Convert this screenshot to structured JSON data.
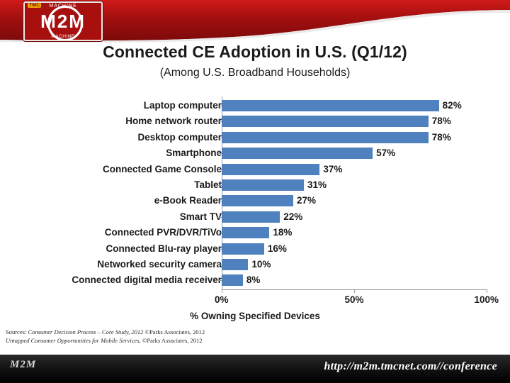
{
  "logo": {
    "top_text": "MACHINE",
    "center_text": "M2M",
    "bottom_text": "MACHINE",
    "badge": "TMC"
  },
  "title": "Connected CE Adoption in U.S. (Q1/12)",
  "subtitle": "(Among U.S. Broadband Households)",
  "chart_data": {
    "type": "bar",
    "orientation": "horizontal",
    "title": "Connected CE Adoption in U.S. (Q1/12)",
    "subtitle": "(Among U.S. Broadband Households)",
    "xlabel": "% Owning Specified Devices",
    "ylabel": "",
    "xlim": [
      0,
      100
    ],
    "xticks": [
      0,
      50,
      100
    ],
    "xtick_labels": [
      "0%",
      "50%",
      "100%"
    ],
    "grid": false,
    "legend": false,
    "bar_color": "#4e81bd",
    "categories": [
      "Laptop computer",
      "Home network router",
      "Desktop computer",
      "Smartphone",
      "Connected Game Console",
      "Tablet",
      "e-Book Reader",
      "Smart TV",
      "Connected PVR/DVR/TiVo",
      "Connected Blu-ray player",
      "Networked security camera",
      "Connected digital media receiver"
    ],
    "values": [
      82,
      78,
      78,
      57,
      37,
      31,
      27,
      22,
      18,
      16,
      10,
      8
    ],
    "value_labels": [
      "82%",
      "78%",
      "78%",
      "57%",
      "37%",
      "31%",
      "27%",
      "22%",
      "18%",
      "16%",
      "10%",
      "8%"
    ]
  },
  "sources": {
    "line1_prefix": "Sources: ",
    "line1_italic": "Consumer Decision Process – Core Study, 2012",
    "line1_suffix": " ©Parks Associates, 2012",
    "line2_italic": "Untapped Consumer Opportunities for Mobile Services",
    "line2_suffix": ", ©Parks Associates, 2012"
  },
  "footer": {
    "brand": "M2M",
    "url": "http://m2m.tmcnet.com//conference"
  }
}
